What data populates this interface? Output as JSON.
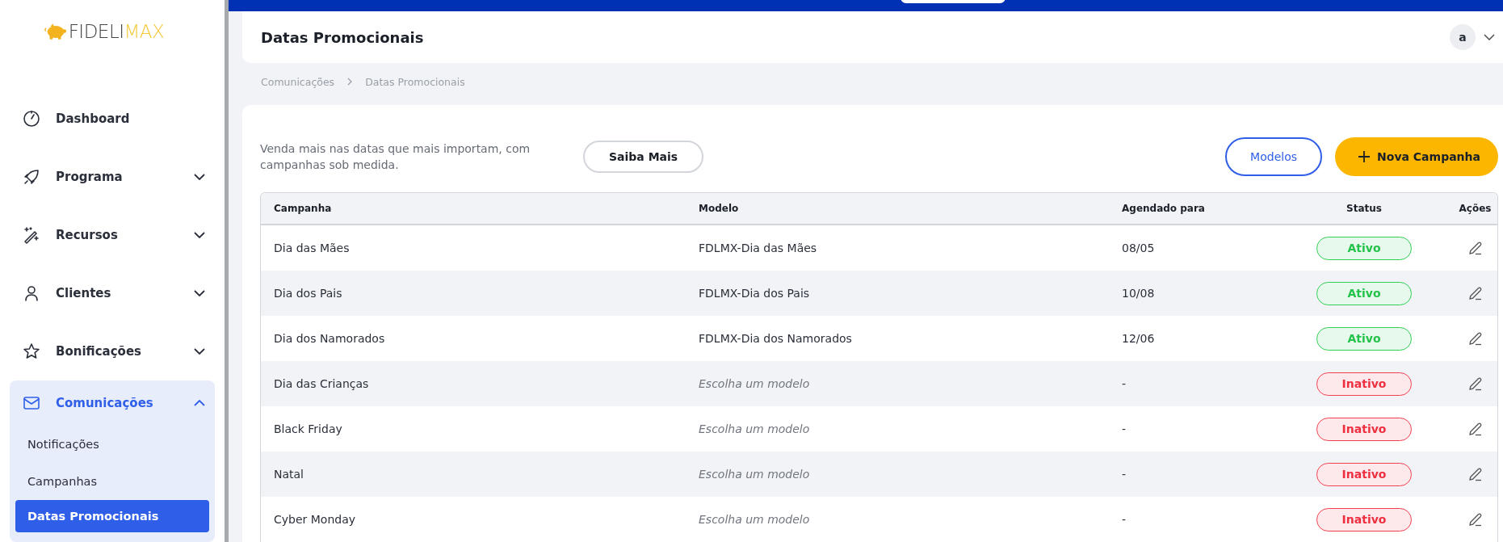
{
  "logo": {
    "text_dark": "FIDELI",
    "text_light": "MAX"
  },
  "sidebar": {
    "items": [
      {
        "label": "Dashboard",
        "expandable": false,
        "expanded": false
      },
      {
        "label": "Programa",
        "expandable": true,
        "expanded": false
      },
      {
        "label": "Recursos",
        "expandable": true,
        "expanded": false
      },
      {
        "label": "Clientes",
        "expandable": true,
        "expanded": false
      },
      {
        "label": "Bonificações",
        "expandable": true,
        "expanded": false
      },
      {
        "label": "Comunicações",
        "expandable": true,
        "expanded": true,
        "children": [
          {
            "label": "Notificações",
            "selected": false
          },
          {
            "label": "Campanhas",
            "selected": false
          },
          {
            "label": "Datas Promocionais",
            "selected": true
          }
        ]
      }
    ]
  },
  "header": {
    "title": "Datas Promocionais",
    "avatar": "a"
  },
  "breadcrumb": [
    "Comunicações",
    "Datas Promocionais"
  ],
  "intro": {
    "text": "Venda mais nas datas que mais importam, com campanhas sob medida.",
    "learn_more": "Saiba Mais"
  },
  "actions": {
    "models": "Modelos",
    "new_campaign": "Nova Campanha"
  },
  "table": {
    "columns": [
      "Campanha",
      "Modelo",
      "Agendado para",
      "Status",
      "Ações"
    ],
    "rows": [
      {
        "campaign": "Dia das Mães",
        "model": "FDLMX-Dia das Mães",
        "model_chosen": true,
        "scheduled": "08/05",
        "status": "Ativo",
        "active": true
      },
      {
        "campaign": "Dia dos Pais",
        "model": "FDLMX-Dia dos Pais",
        "model_chosen": true,
        "scheduled": "10/08",
        "status": "Ativo",
        "active": true
      },
      {
        "campaign": "Dia dos Namorados",
        "model": "FDLMX-Dia dos Namorados",
        "model_chosen": true,
        "scheduled": "12/06",
        "status": "Ativo",
        "active": true
      },
      {
        "campaign": "Dia das Crianças",
        "model": "Escolha um modelo",
        "model_chosen": false,
        "scheduled": "-",
        "status": "Inativo",
        "active": false
      },
      {
        "campaign": "Black Friday",
        "model": "Escolha um modelo",
        "model_chosen": false,
        "scheduled": "-",
        "status": "Inativo",
        "active": false
      },
      {
        "campaign": "Natal",
        "model": "Escolha um modelo",
        "model_chosen": false,
        "scheduled": "-",
        "status": "Inativo",
        "active": false
      },
      {
        "campaign": "Cyber Monday",
        "model": "Escolha um modelo",
        "model_chosen": false,
        "scheduled": "-",
        "status": "Inativo",
        "active": false
      }
    ]
  }
}
